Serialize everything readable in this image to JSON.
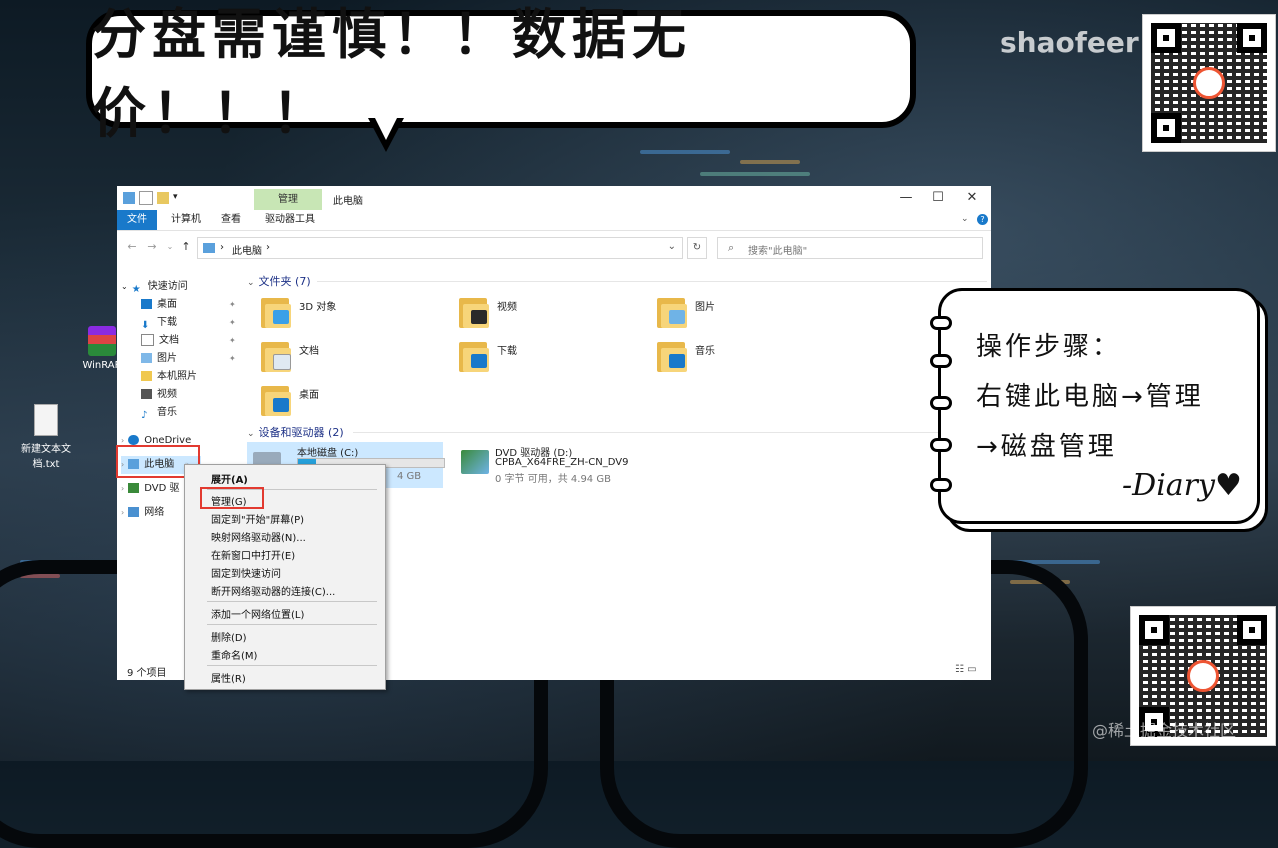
{
  "banner": {
    "text": "分盘需谨慎！！数据无价！！！"
  },
  "watermark": "shaofeer",
  "footer_mark": "@稀土掘金技术社区",
  "desktop": {
    "icons": [
      {
        "label": "WinRAR",
        "icon": "winrar-icon"
      },
      {
        "label": "新建文本文档.txt",
        "icon": "text-file-icon"
      }
    ]
  },
  "explorer": {
    "title": "此电脑",
    "context_tab_header": "管理",
    "ribbon_tabs": [
      "文件",
      "计算机",
      "查看",
      "驱动器工具"
    ],
    "window_buttons": {
      "minimize": "—",
      "maximize": "☐",
      "close": "✕"
    },
    "address": {
      "path": "此电脑",
      "separator": "›"
    },
    "search": {
      "placeholder": "搜索\"此电脑\""
    },
    "nav": {
      "quick_access": "快速访问",
      "quick_items": [
        "桌面",
        "下载",
        "文档",
        "图片",
        "本机照片",
        "视频",
        "音乐"
      ],
      "onedrive": "OneDrive",
      "this_pc": "此电脑",
      "dvd": "DVD 驱",
      "network": "网络"
    },
    "folders_header": "文件夹 (7)",
    "folders": [
      {
        "name": "3D 对象",
        "color": "#3aa0e8"
      },
      {
        "name": "视频",
        "color": "#2a2a2a"
      },
      {
        "name": "图片",
        "color": "#6fb3e6"
      },
      {
        "name": "文档",
        "color": "#dfe9f2"
      },
      {
        "name": "下载",
        "color": "#1979ca"
      },
      {
        "name": "音乐",
        "color": "#1979ca"
      },
      {
        "name": "桌面",
        "color": "#1979ca"
      }
    ],
    "devices_header": "设备和驱动器 (2)",
    "drives": [
      {
        "name": "本地磁盘 (C:)",
        "detail": "4 GB",
        "used_fraction": 0.12
      },
      {
        "name": "DVD 驱动器 (D:)",
        "label": "CPBA_X64FRE_ZH-CN_DV9",
        "detail": "0 字节 可用，共 4.94 GB"
      }
    ],
    "status": "9 个项目"
  },
  "context_menu": {
    "items": [
      "展开(A)",
      "管理(G)",
      "固定到\"开始\"屏幕(P)",
      "映射网络驱动器(N)...",
      "在新窗口中打开(E)",
      "固定到快速访问",
      "断开网络驱动器的连接(C)...",
      "添加一个网络位置(L)",
      "删除(D)",
      "重命名(M)",
      "属性(R)"
    ]
  },
  "note": {
    "lines": [
      "操作步骤：",
      "右键此电脑→管理",
      "→磁盘管理"
    ],
    "sign": "-Diary♥"
  },
  "colors": {
    "accent_blue": "#1979ca",
    "highlight_red": "#e23a30",
    "context_tab_green": "#c8e6b5"
  }
}
